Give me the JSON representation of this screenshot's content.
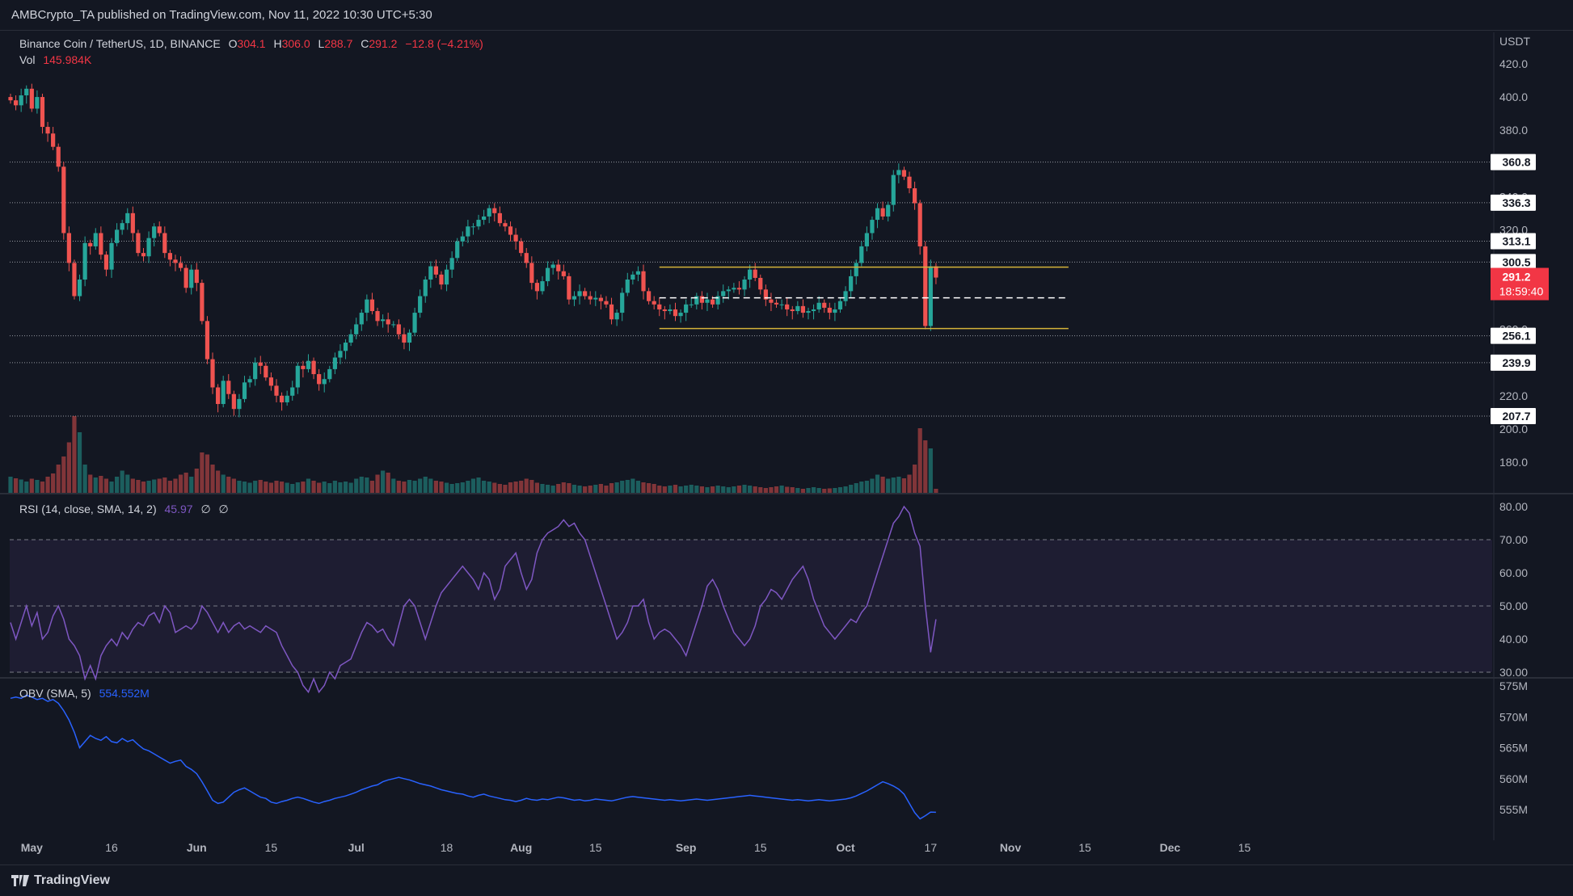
{
  "header": {
    "published_text": "AMBCrypto_TA published on TradingView.com, Nov 11, 2022 10:30 UTC+5:30"
  },
  "footer": {
    "brand": "TradingView"
  },
  "legend": {
    "symbol": "Binance Coin / TetherUS, 1D, BINANCE",
    "o_label": "O",
    "o_value": "304.1",
    "h_label": "H",
    "h_value": "306.0",
    "l_label": "L",
    "l_value": "288.7",
    "c_label": "C",
    "c_value": "291.2",
    "change": "−12.8 (−4.21%)",
    "vol_label": "Vol",
    "vol_value": "145.984K",
    "rsi_label": "RSI (14, close, SMA, 14, 2)",
    "rsi_value": "45.97",
    "rsi_extra1": "∅",
    "rsi_extra2": "∅",
    "obv_label": "OBV (SMA, 5)",
    "obv_value": "554.552M"
  },
  "colors": {
    "background": "#131722",
    "up": "#26a69a",
    "down": "#ef5350",
    "rsi": "#7e57c2",
    "obv": "#2962ff",
    "range_box": "#d4b33a",
    "price_tag": "#f23645"
  },
  "chart_data": [
    {
      "type": "candlestick",
      "title": "Binance Coin / TetherUS, 1D, BINANCE",
      "currency": "USDT",
      "ylim": [
        160,
        425
      ],
      "y_ticks": [
        "420.0",
        "400.0",
        "380.0",
        "340.0",
        "320.0",
        "260.0",
        "220.0",
        "200.0",
        "180.0"
      ],
      "x_ticks": [
        "May",
        "16",
        "Jun",
        "15",
        "Jul",
        "18",
        "Aug",
        "15",
        "Sep",
        "15",
        "Oct",
        "17",
        "Nov",
        "15",
        "Dec",
        "15"
      ],
      "x_ticks_dates": [
        "2022-05-01",
        "2022-05-16",
        "2022-06-01",
        "2022-06-15",
        "2022-07-01",
        "2022-07-18",
        "2022-08-01",
        "2022-08-15",
        "2022-09-01",
        "2022-09-15",
        "2022-10-01",
        "2022-10-17",
        "2022-11-01",
        "2022-11-15",
        "2022-12-01",
        "2022-12-15"
      ],
      "date_start": "2022-04-27",
      "levels": [
        {
          "label": "360.8",
          "value": 360.8
        },
        {
          "label": "336.3",
          "value": 336.3
        },
        {
          "label": "313.1",
          "value": 313.1
        },
        {
          "label": "300.5",
          "value": 300.5
        },
        {
          "label": "256.1",
          "value": 256.1
        },
        {
          "label": "239.9",
          "value": 239.9
        },
        {
          "label": "207.7",
          "value": 207.7
        }
      ],
      "last_price": {
        "label": "291.2",
        "countdown": "18:59:40",
        "value": 291.2
      },
      "range_box": {
        "start": "2022-08-27",
        "end": "2022-11-11",
        "top": 297.5,
        "mid": 279.0,
        "bottom": 260.5
      },
      "closes": [
        398.0,
        395.0,
        401.0,
        405.0,
        393.0,
        400.0,
        382.0,
        378.0,
        370.0,
        358.0,
        318.0,
        300.0,
        280.0,
        290.0,
        312.0,
        310.0,
        318.0,
        305.0,
        296.0,
        312.0,
        320.0,
        324.0,
        330.0,
        318.0,
        306.0,
        304.0,
        315.0,
        322.0,
        318.0,
        306.0,
        302.0,
        300.0,
        297.0,
        285.0,
        296.0,
        288.0,
        265.0,
        242.0,
        225.0,
        215.0,
        229.0,
        221.0,
        212.0,
        218.0,
        228.0,
        230.0,
        240.0,
        238.0,
        231.0,
        226.0,
        220.0,
        216.0,
        220.0,
        225.0,
        238.0,
        236.0,
        241.0,
        233.0,
        227.0,
        230.0,
        236.0,
        243.0,
        247.0,
        252.0,
        257.0,
        263.0,
        270.0,
        278.0,
        271.0,
        265.0,
        266.0,
        263.0,
        263.0,
        257.0,
        252.0,
        258.0,
        270.0,
        280.0,
        290.0,
        298.0,
        293.0,
        287.0,
        296.0,
        303.0,
        313.0,
        316.0,
        322.0,
        322.0,
        326.0,
        328.0,
        333.0,
        330.0,
        324.0,
        322.0,
        317.0,
        313.0,
        306.0,
        300.0,
        288.0,
        283.0,
        289.0,
        297.0,
        299.0,
        295.0,
        292.0,
        278.0,
        280.0,
        283.0,
        280.0,
        278.0,
        279.0,
        277.0,
        275.0,
        266.0,
        270.0,
        282.0,
        290.0,
        293.0,
        295.0,
        283.0,
        277.0,
        275.0,
        272.0,
        271.0,
        272.0,
        268.0,
        270.0,
        275.0,
        275.0,
        280.0,
        276.0,
        278.0,
        275.0,
        280.0,
        283.0,
        284.0,
        285.0,
        284.0,
        290.0,
        296.0,
        291.0,
        284.0,
        278.0,
        276.0,
        275.0,
        275.0,
        272.0,
        271.0,
        274.0,
        270.0,
        271.0,
        272.0,
        276.0,
        273.0,
        270.0,
        272.0,
        277.0,
        283.0,
        292.0,
        300.0,
        310.0,
        318.0,
        326.0,
        333.0,
        328.0,
        335.0,
        353.0,
        356.0,
        352.0,
        345.0,
        336.0,
        310.0,
        262.0,
        298.0,
        291.2
      ],
      "volume_ylim": [
        0,
        220
      ],
      "volume": [
        40,
        36,
        33,
        28,
        35,
        32,
        28,
        40,
        48,
        70,
        90,
        125,
        190,
        150,
        70,
        45,
        38,
        42,
        35,
        28,
        40,
        55,
        45,
        35,
        32,
        28,
        30,
        33,
        35,
        38,
        30,
        35,
        45,
        50,
        40,
        60,
        100,
        95,
        70,
        55,
        45,
        40,
        35,
        30,
        28,
        25,
        30,
        32,
        28,
        25,
        30,
        28,
        25,
        22,
        26,
        28,
        35,
        30,
        25,
        28,
        24,
        30,
        26,
        28,
        25,
        35,
        40,
        38,
        30,
        45,
        55,
        50,
        35,
        30,
        28,
        32,
        30,
        35,
        40,
        35,
        30,
        28,
        25,
        22,
        24,
        26,
        30,
        35,
        38,
        30,
        28,
        25,
        22,
        20,
        26,
        28,
        30,
        35,
        32,
        25,
        22,
        20,
        18,
        22,
        26,
        24,
        20,
        18,
        16,
        18,
        20,
        22,
        18,
        24,
        26,
        30,
        32,
        35,
        30,
        26,
        24,
        22,
        18,
        16,
        18,
        20,
        16,
        18,
        20,
        18,
        16,
        14,
        16,
        18,
        16,
        14,
        16,
        18,
        20,
        18,
        16,
        14,
        12,
        14,
        16,
        18,
        15,
        14,
        12,
        10,
        12,
        14,
        12,
        10,
        11,
        12,
        14,
        16,
        20,
        24,
        28,
        30,
        35,
        45,
        40,
        35,
        38,
        40,
        36,
        45,
        70,
        160,
        130,
        110,
        10
      ]
    },
    {
      "type": "line",
      "title": "RSI (14, close, SMA, 14, 2)",
      "ylim": [
        24,
        82
      ],
      "y_ticks": [
        "80.00",
        "70.00",
        "60.00",
        "50.00",
        "40.00",
        "30.00"
      ],
      "bands": [
        70,
        50,
        30
      ],
      "last_value": 45.97,
      "values": [
        45.0,
        40.0,
        45.0,
        50.0,
        44.0,
        48.0,
        40.0,
        42.0,
        47.0,
        50.0,
        46.0,
        40.0,
        38.0,
        35.0,
        28.0,
        32.0,
        28.0,
        35.0,
        38.0,
        40.0,
        38.0,
        42.0,
        40.0,
        43.0,
        45.0,
        44.0,
        47.0,
        48.0,
        45.0,
        50.0,
        48.0,
        42.0,
        43.0,
        44.0,
        43.0,
        45.0,
        50.0,
        48.0,
        45.0,
        42.0,
        45.0,
        42.0,
        44.0,
        45.0,
        43.0,
        44.0,
        43.0,
        42.0,
        44.0,
        43.0,
        42.0,
        38.0,
        35.0,
        32.0,
        30.0,
        26.0,
        24.0,
        28.0,
        24.0,
        26.0,
        30.0,
        28.0,
        32.0,
        33.0,
        34.0,
        38.0,
        42.0,
        45.0,
        44.0,
        42.0,
        43.0,
        40.0,
        38.0,
        44.0,
        50.0,
        52.0,
        50.0,
        45.0,
        40.0,
        45.0,
        50.0,
        54.0,
        56.0,
        58.0,
        60.0,
        62.0,
        60.0,
        58.0,
        55.0,
        60.0,
        58.0,
        52.0,
        55.0,
        62.0,
        64.0,
        66.0,
        60.0,
        55.0,
        58.0,
        66.0,
        70.0,
        72.0,
        73.0,
        74.0,
        76.0,
        74.0,
        75.0,
        72.0,
        70.0,
        65.0,
        60.0,
        55.0,
        50.0,
        45.0,
        40.0,
        42.0,
        45.0,
        50.0,
        50.0,
        52.0,
        45.0,
        40.0,
        42.0,
        43.0,
        42.0,
        40.0,
        38.0,
        35.0,
        40.0,
        45.0,
        50.0,
        56.0,
        58.0,
        55.0,
        50.0,
        46.0,
        42.0,
        40.0,
        38.0,
        40.0,
        44.0,
        50.0,
        52.0,
        55.0,
        54.0,
        52.0,
        55.0,
        58.0,
        60.0,
        62.0,
        58.0,
        52.0,
        48.0,
        44.0,
        42.0,
        40.0,
        42.0,
        44.0,
        46.0,
        45.0,
        48.0,
        50.0,
        55.0,
        60.0,
        65.0,
        70.0,
        75.0,
        77.0,
        80.0,
        78.0,
        72.0,
        68.0,
        50.0,
        36.0,
        45.97
      ]
    },
    {
      "type": "line",
      "title": "OBV (SMA, 5)",
      "unit": "M",
      "ylim": [
        553.0,
        576.0
      ],
      "y_ticks": [
        "575M",
        "570M",
        "565M",
        "560M",
        "555M"
      ],
      "last_value": 554.552,
      "values": [
        573.0,
        573.2,
        573.0,
        573.5,
        573.2,
        572.8,
        573.0,
        572.5,
        572.8,
        572.2,
        571.0,
        569.5,
        567.5,
        565.0,
        566.0,
        567.0,
        566.5,
        566.2,
        566.8,
        566.0,
        565.8,
        566.5,
        566.0,
        566.3,
        565.5,
        564.8,
        564.5,
        564.0,
        563.5,
        563.0,
        562.5,
        562.8,
        563.0,
        562.0,
        561.5,
        560.8,
        559.5,
        558.0,
        556.5,
        556.0,
        556.2,
        557.0,
        557.8,
        558.2,
        558.5,
        558.0,
        557.5,
        557.0,
        556.8,
        556.2,
        556.0,
        556.3,
        556.5,
        556.8,
        557.0,
        556.8,
        556.5,
        556.2,
        556.0,
        556.3,
        556.5,
        556.8,
        557.0,
        557.2,
        557.5,
        557.8,
        558.2,
        558.5,
        558.8,
        559.0,
        559.5,
        559.8,
        560.0,
        560.2,
        560.0,
        559.8,
        559.5,
        559.2,
        559.0,
        558.8,
        558.5,
        558.2,
        558.0,
        557.8,
        557.6,
        557.5,
        557.2,
        557.0,
        557.3,
        557.5,
        557.2,
        557.0,
        556.8,
        556.6,
        556.5,
        556.3,
        556.5,
        556.8,
        556.6,
        556.5,
        556.7,
        556.6,
        556.8,
        557.0,
        556.9,
        556.7,
        556.5,
        556.6,
        556.4,
        556.5,
        556.7,
        556.6,
        556.5,
        556.4,
        556.6,
        556.8,
        557.0,
        557.1,
        557.0,
        556.9,
        556.8,
        556.7,
        556.6,
        556.5,
        556.6,
        556.5,
        556.4,
        556.5,
        556.6,
        556.7,
        556.6,
        556.5,
        556.6,
        556.7,
        556.8,
        556.9,
        557.0,
        557.1,
        557.2,
        557.3,
        557.2,
        557.1,
        557.0,
        556.9,
        556.8,
        556.7,
        556.6,
        556.5,
        556.6,
        556.5,
        556.4,
        556.5,
        556.6,
        556.5,
        556.4,
        556.5,
        556.6,
        556.7,
        556.9,
        557.2,
        557.6,
        558.0,
        558.5,
        559.0,
        559.5,
        559.2,
        558.8,
        558.3,
        557.5,
        556.0,
        554.5,
        553.5,
        554.0,
        554.6,
        554.552
      ]
    }
  ]
}
